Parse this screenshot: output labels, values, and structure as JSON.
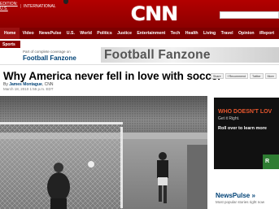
{
  "header": {
    "edition_label": "EDITION: U.S.",
    "edition_sep": "|",
    "edition_international": "INTERNATIONAL",
    "logo_text": "CNN"
  },
  "nav": {
    "items": [
      "Home",
      "Video",
      "NewsPulse",
      "U.S.",
      "World",
      "Politics",
      "Justice",
      "Entertainment",
      "Tech",
      "Health",
      "Living",
      "Travel",
      "Opinion",
      "iReport"
    ]
  },
  "subnav": {
    "section_tab": "Sports",
    "coverage_text": "Part of complete coverage on",
    "fanzone_link": "Football Fanzone",
    "banner_text": "Football Fanzone"
  },
  "article": {
    "headline": "Why America never fell in love with soccer",
    "byline_prefix": "By",
    "author": "James Montague",
    "outlet": ", CNN",
    "date": "March 18, 2010 1:55 p.m. EDT"
  },
  "share": {
    "labels": [
      "Share",
      "f Recommend",
      "Twitter",
      "More"
    ]
  },
  "ad": {
    "line1": "WHO DOESN'T LOV",
    "line2": "Get it Right.",
    "cta": "Roll over to learn more",
    "badge": "R"
  },
  "sidebar": {
    "newspulse_title": "NewsPulse »",
    "newspulse_sub": "Most popular stories right now"
  },
  "colors": {
    "brand_red": "#b30000",
    "nav_red": "#7d0000",
    "link_blue": "#004276"
  }
}
